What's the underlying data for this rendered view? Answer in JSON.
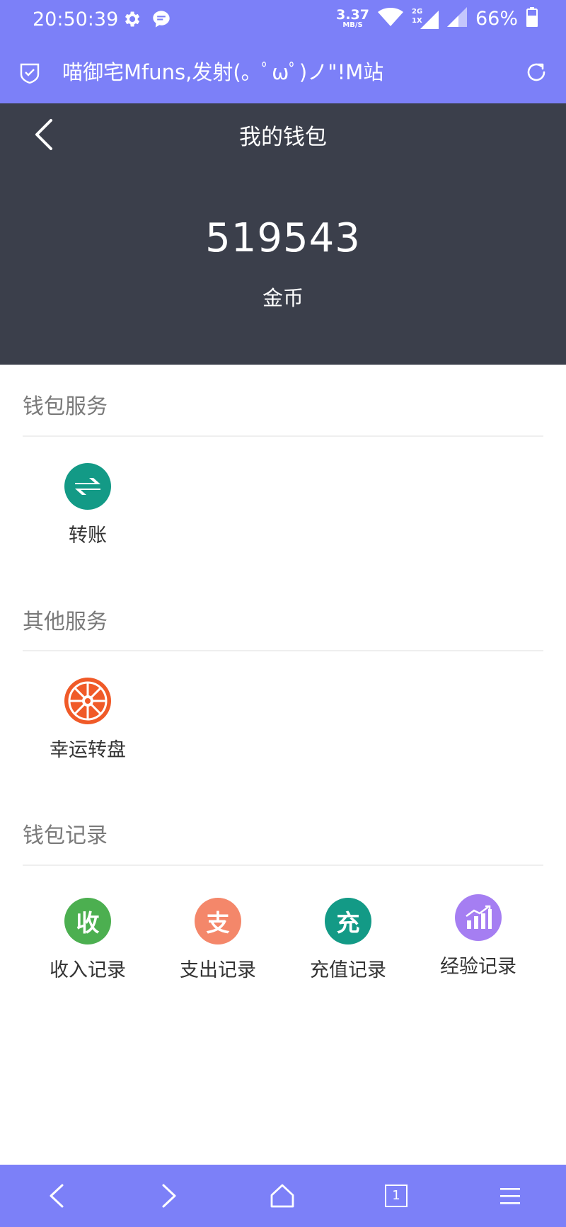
{
  "colors": {
    "accent": "#7c80f8",
    "header": "#3b3f4b",
    "transfer_icon": "#139a86",
    "wheel_icon": "#f05a28",
    "income_icon": "#4caf50",
    "expense_icon": "#f4876a",
    "recharge_icon": "#139a86",
    "exp_icon": "#a57ef2"
  },
  "status_bar": {
    "time": "20:50:39",
    "net_speed_value": "3.37",
    "net_speed_unit": "MB/S",
    "network_label": "2G",
    "network_label2": "1X",
    "battery": "66%"
  },
  "browser": {
    "page_title": "喵御宅Mfuns,发射(。ﾟωﾟ)ノ\"!M站"
  },
  "wallet": {
    "title": "我的钱包",
    "balance": "519543",
    "unit": "金币"
  },
  "sections": {
    "wallet_services": {
      "title": "钱包服务",
      "items": [
        {
          "label": "转账",
          "icon": "transfer-icon"
        }
      ]
    },
    "other_services": {
      "title": "其他服务",
      "items": [
        {
          "label": "幸运转盘",
          "icon": "lucky-wheel-icon"
        }
      ]
    },
    "wallet_records": {
      "title": "钱包记录",
      "items": [
        {
          "label": "收入记录",
          "glyph": "收",
          "icon": "income-icon"
        },
        {
          "label": "支出记录",
          "glyph": "支",
          "icon": "expense-icon"
        },
        {
          "label": "充值记录",
          "glyph": "充",
          "icon": "recharge-icon"
        },
        {
          "label": "经验记录",
          "icon": "experience-chart-icon"
        }
      ]
    }
  },
  "bottom_nav": {
    "tab_count": "1"
  }
}
